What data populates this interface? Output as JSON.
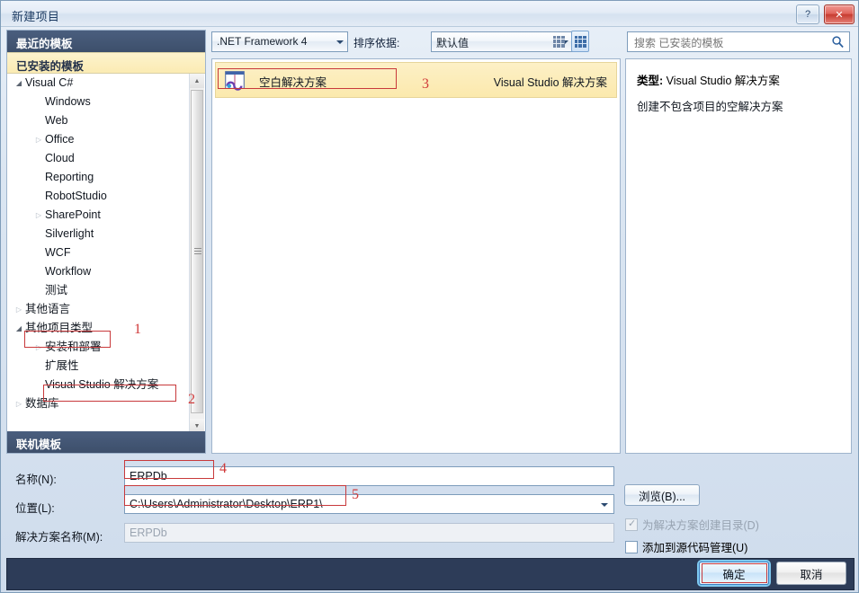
{
  "window": {
    "title": "新建项目",
    "help_label": "?",
    "close_label": "✕"
  },
  "toolbar": {
    "framework": ".NET Framework 4",
    "sort_label": "排序依据:",
    "sort_value": "默认值",
    "view_large_icon": "large-icons-icon",
    "view_small_icon": "small-icons-icon",
    "search_placeholder": "搜索 已安装的模板",
    "search_value": "",
    "search_icon": "search-icon"
  },
  "sidebar": {
    "header_recent": "最近的模板",
    "header_installed": "已安装的模板",
    "header_online": "联机模板",
    "tree": [
      {
        "label": "Visual C#",
        "level": 1,
        "twisty": "expanded"
      },
      {
        "label": "Windows",
        "level": 2,
        "twisty": "empty"
      },
      {
        "label": "Web",
        "level": 2,
        "twisty": "empty"
      },
      {
        "label": "Office",
        "level": 2,
        "twisty": "collapsed"
      },
      {
        "label": "Cloud",
        "level": 2,
        "twisty": "empty"
      },
      {
        "label": "Reporting",
        "level": 2,
        "twisty": "empty"
      },
      {
        "label": "RobotStudio",
        "level": 2,
        "twisty": "empty"
      },
      {
        "label": "SharePoint",
        "level": 2,
        "twisty": "collapsed"
      },
      {
        "label": "Silverlight",
        "level": 2,
        "twisty": "empty"
      },
      {
        "label": "WCF",
        "level": 2,
        "twisty": "empty"
      },
      {
        "label": "Workflow",
        "level": 2,
        "twisty": "empty"
      },
      {
        "label": "测试",
        "level": 2,
        "twisty": "empty"
      },
      {
        "label": "其他语言",
        "level": 1,
        "twisty": "collapsed"
      },
      {
        "label": "其他项目类型",
        "level": 1,
        "twisty": "expanded"
      },
      {
        "label": "安装和部署",
        "level": 2,
        "twisty": "collapsed"
      },
      {
        "label": "扩展性",
        "level": 2,
        "twisty": "empty"
      },
      {
        "label": "Visual Studio 解决方案",
        "level": 2,
        "twisty": "empty"
      },
      {
        "label": "数据库",
        "level": 1,
        "twisty": "collapsed"
      }
    ]
  },
  "templates": [
    {
      "name": "空白解决方案",
      "category": "Visual Studio 解决方案",
      "icon": "blank-solution-icon"
    }
  ],
  "detail": {
    "type_label": "类型:",
    "type_value": "Visual Studio 解决方案",
    "description": "创建不包含项目的空解决方案"
  },
  "form": {
    "name_label": "名称(N):",
    "name_value": "ERPDb",
    "location_label": "位置(L):",
    "location_value": "C:\\Users\\Administrator\\Desktop\\ERP1\\",
    "solution_label": "解决方案名称(M):",
    "solution_value": "ERPDb",
    "browse_label": "浏览(B)...",
    "create_dir_label": "为解决方案创建目录(D)",
    "create_dir_checked": true,
    "source_control_label": "添加到源代码管理(U)",
    "source_control_checked": false
  },
  "footer": {
    "ok_label": "确定",
    "cancel_label": "取消"
  },
  "annotations": [
    {
      "number": "1"
    },
    {
      "number": "2"
    },
    {
      "number": "3"
    },
    {
      "number": "4"
    },
    {
      "number": "5"
    }
  ],
  "colors": {
    "accent_blue": "#3d4f6b",
    "selected_yellow": "#fbe9ad",
    "annotation_red": "#d03a3a",
    "footer_navy": "#2d3c58"
  }
}
